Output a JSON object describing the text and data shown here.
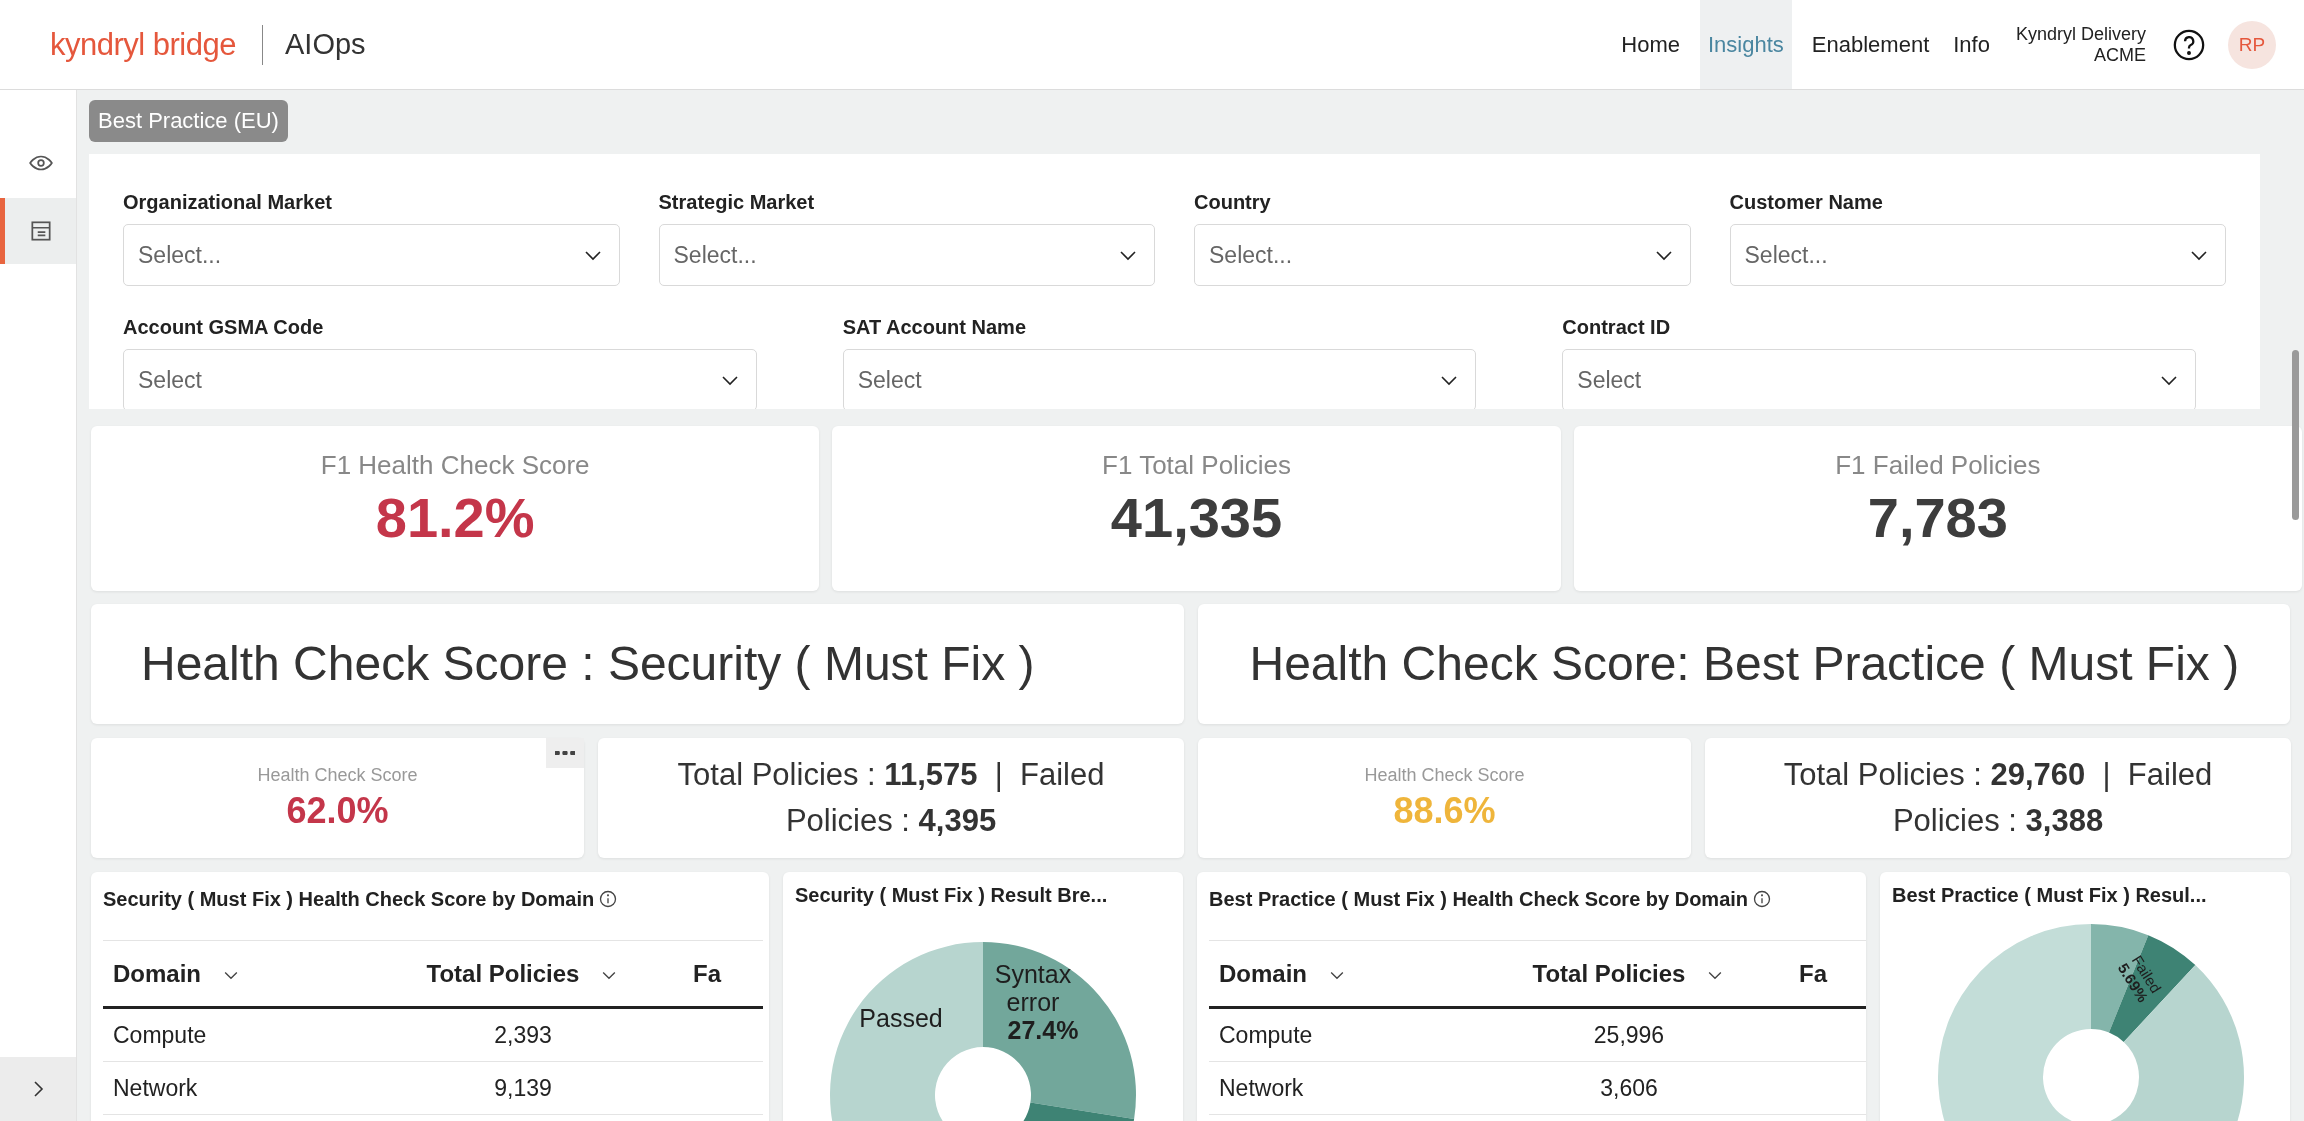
{
  "header": {
    "brand": "kyndryl bridge",
    "product": "AIOps",
    "nav": [
      {
        "label": "Home",
        "selected": false
      },
      {
        "label": "Insights",
        "selected": true
      },
      {
        "label": "Enablement",
        "selected": false
      },
      {
        "label": "Info",
        "selected": false
      }
    ],
    "account": {
      "line_1": "Kyndryl Delivery",
      "line_2": "ACME"
    },
    "avatar": "RP"
  },
  "sidebar": {
    "items": [
      {
        "kind": "eye",
        "selected": false
      },
      {
        "kind": "table",
        "selected": true
      }
    ]
  },
  "view_tag": "Best Practice (EU)",
  "filter_rows": [
    {
      "filters": [
        {
          "label": "Organizational Market",
          "placeholder": "Select..."
        },
        {
          "label": "Strategic Market",
          "placeholder": "Select..."
        },
        {
          "label": "Country",
          "placeholder": "Select..."
        },
        {
          "label": "Customer Name",
          "placeholder": "Select..."
        }
      ]
    },
    {
      "filters": [
        {
          "label": "Account GSMA Code",
          "placeholder": "Select"
        },
        {
          "label": "SAT Account Name",
          "placeholder": "Select"
        },
        {
          "label": "Contract ID",
          "placeholder": "Select"
        }
      ]
    }
  ],
  "kpis": [
    {
      "label": "F1 Health Check Score",
      "value": "81.2%",
      "color": "#c4364a"
    },
    {
      "label": "F1 Total Policies",
      "value": "41,335",
      "color": "#3d3d3d"
    },
    {
      "label": "F1 Failed Policies",
      "value": "7,783",
      "color": "#3d3d3d"
    }
  ],
  "sections": [
    {
      "title": "Health Check Score : Security ( Must Fix )",
      "score": {
        "label": "Health Check Score",
        "value": "62.0%",
        "color": "#c4364a",
        "menu": true
      },
      "totals": "Total Policies : **11,575**  |  Failed Policies : **4,395**",
      "table": {
        "title": "Security ( Must Fix ) Health Check Score by Domain",
        "columns": [
          {
            "label": "Domain",
            "sortable": true
          },
          {
            "label": "Total Policies",
            "sortable": true
          },
          {
            "label": "Fa",
            "sortable": false
          }
        ],
        "rows": [
          [
            "Compute",
            "2,393"
          ],
          [
            "Network",
            "9,139"
          ]
        ]
      },
      "pie": {
        "title": "Security ( Must Fix ) Result Bre...",
        "slice_labels": [
          {
            "label": "Passed"
          },
          {
            "label": "Syntax error",
            "value_label": "27.4%"
          }
        ]
      }
    },
    {
      "title": "Health Check Score: Best Practice ( Must Fix )",
      "score": {
        "label": "Health Check Score",
        "value": "88.6%",
        "color": "#efb53b",
        "menu": false
      },
      "totals": "Total Policies : **29,760**  |  Failed Policies : **3,388**",
      "table": {
        "title": "Best Practice ( Must Fix ) Health Check Score by Domain",
        "columns": [
          {
            "label": "Domain",
            "sortable": true
          },
          {
            "label": "Total Policies",
            "sortable": true
          },
          {
            "label": "Fa",
            "sortable": false
          }
        ],
        "rows": [
          [
            "Compute",
            "25,996"
          ],
          [
            "Network",
            "3,606"
          ]
        ]
      },
      "pie": {
        "title": "Best Practice ( Must Fix ) Resul...",
        "slice_labels": [
          {
            "label": "Failed",
            "value_label": "5.69%"
          }
        ]
      }
    }
  ]
}
